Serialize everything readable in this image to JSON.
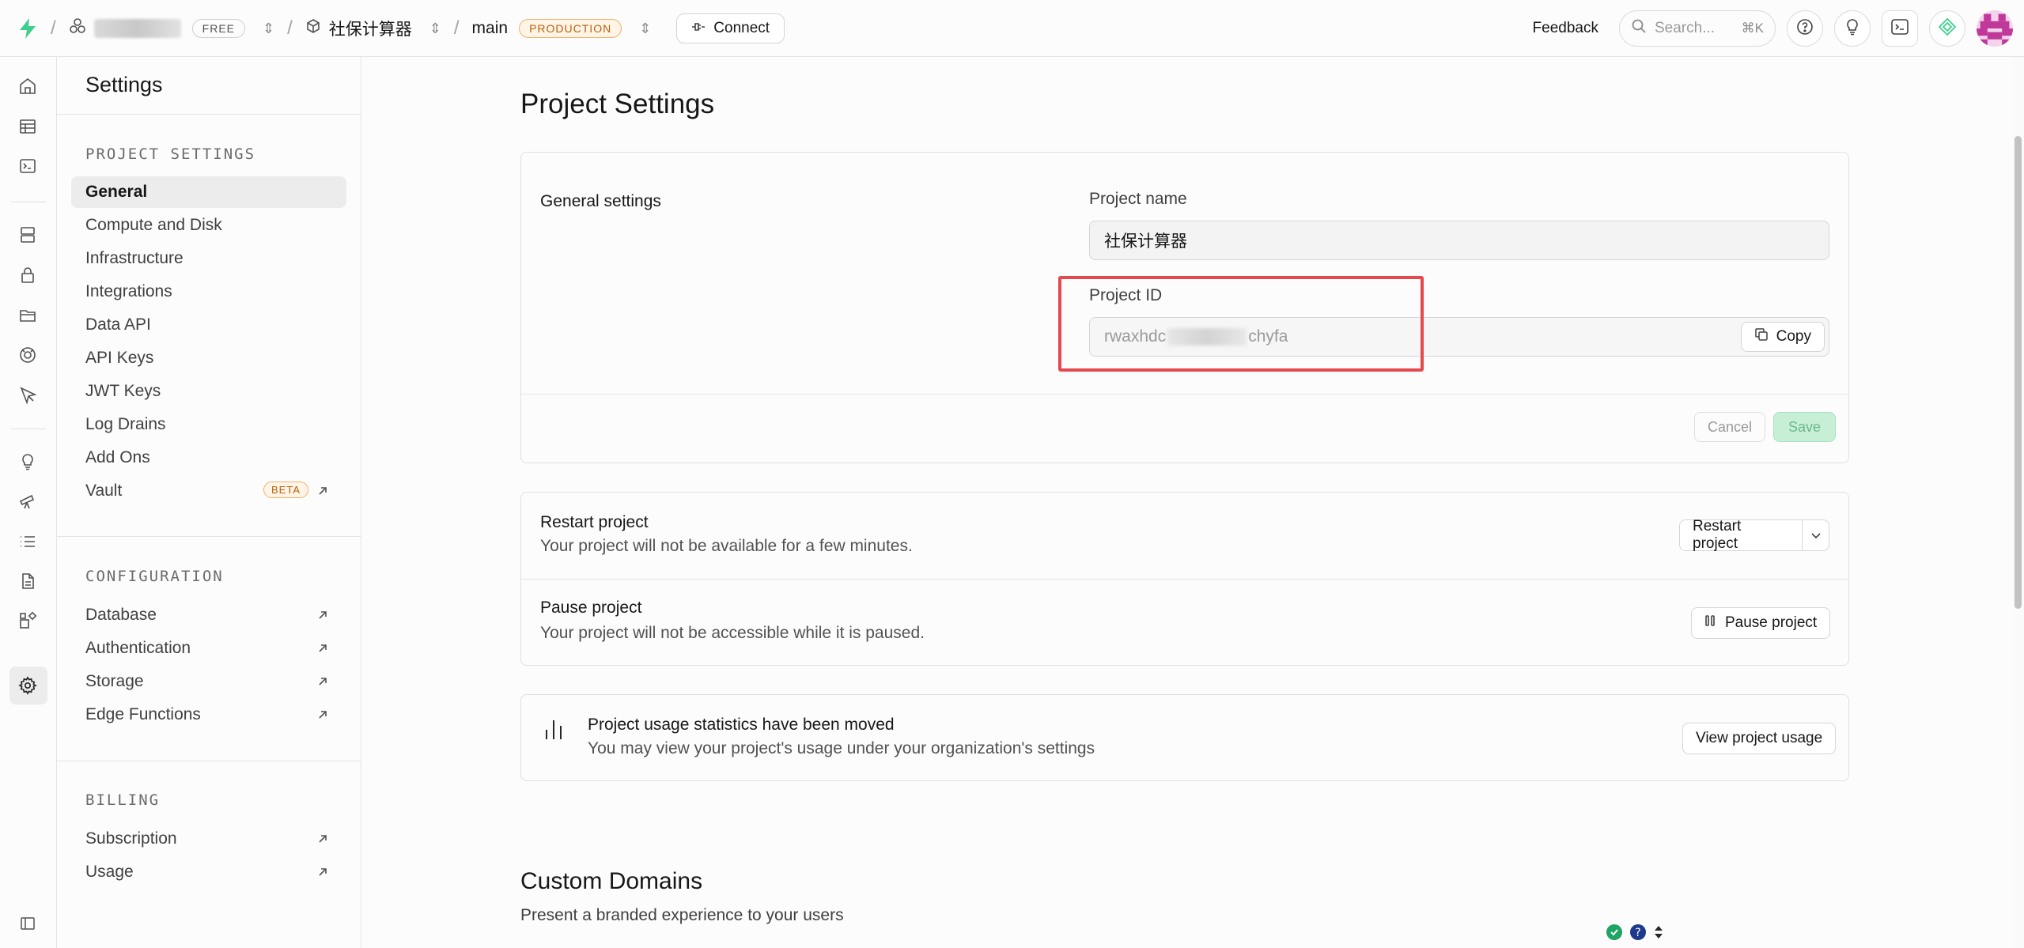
{
  "topbar": {
    "org_plan_badge": "FREE",
    "project_name": "社保计算器",
    "branch_name": "main",
    "branch_badge": "PRODUCTION",
    "connect_label": "Connect",
    "feedback_label": "Feedback",
    "search_placeholder": "Search...",
    "search_shortcut": "⌘K"
  },
  "sidebar": {
    "title": "Settings",
    "sections": [
      {
        "heading": "PROJECT SETTINGS",
        "items": [
          {
            "label": "General",
            "active": true
          },
          {
            "label": "Compute and Disk"
          },
          {
            "label": "Infrastructure"
          },
          {
            "label": "Integrations"
          },
          {
            "label": "Data API"
          },
          {
            "label": "API Keys"
          },
          {
            "label": "JWT Keys"
          },
          {
            "label": "Log Drains"
          },
          {
            "label": "Add Ons"
          },
          {
            "label": "Vault",
            "badge": "BETA",
            "external": true
          }
        ]
      },
      {
        "heading": "CONFIGURATION",
        "items": [
          {
            "label": "Database",
            "external": true
          },
          {
            "label": "Authentication",
            "external": true
          },
          {
            "label": "Storage",
            "external": true
          },
          {
            "label": "Edge Functions",
            "external": true
          }
        ]
      },
      {
        "heading": "BILLING",
        "items": [
          {
            "label": "Subscription",
            "external": true
          },
          {
            "label": "Usage",
            "external": true
          }
        ]
      }
    ]
  },
  "main": {
    "page_title": "Project Settings",
    "general": {
      "section_label": "General settings",
      "project_name_label": "Project name",
      "project_name_value": "社保计算器",
      "project_id_label": "Project ID",
      "project_id_prefix": "rwaxhdc",
      "project_id_suffix": "chyfa",
      "copy_label": "Copy",
      "cancel_label": "Cancel",
      "save_label": "Save"
    },
    "restart": {
      "title": "Restart project",
      "desc": "Your project will not be available for a few minutes.",
      "button": "Restart project"
    },
    "pause": {
      "title": "Pause project",
      "desc": "Your project will not be accessible while it is paused.",
      "button": "Pause project"
    },
    "usage": {
      "title": "Project usage statistics have been moved",
      "desc": "You may view your project's usage under your organization's settings",
      "button": "View project usage"
    },
    "custom_domains": {
      "title": "Custom Domains",
      "desc": "Present a branded experience to your users"
    }
  },
  "colors": {
    "accent_green": "#3ecf8e",
    "highlight_red": "#e5484d",
    "production_orange": "#b8620c"
  }
}
